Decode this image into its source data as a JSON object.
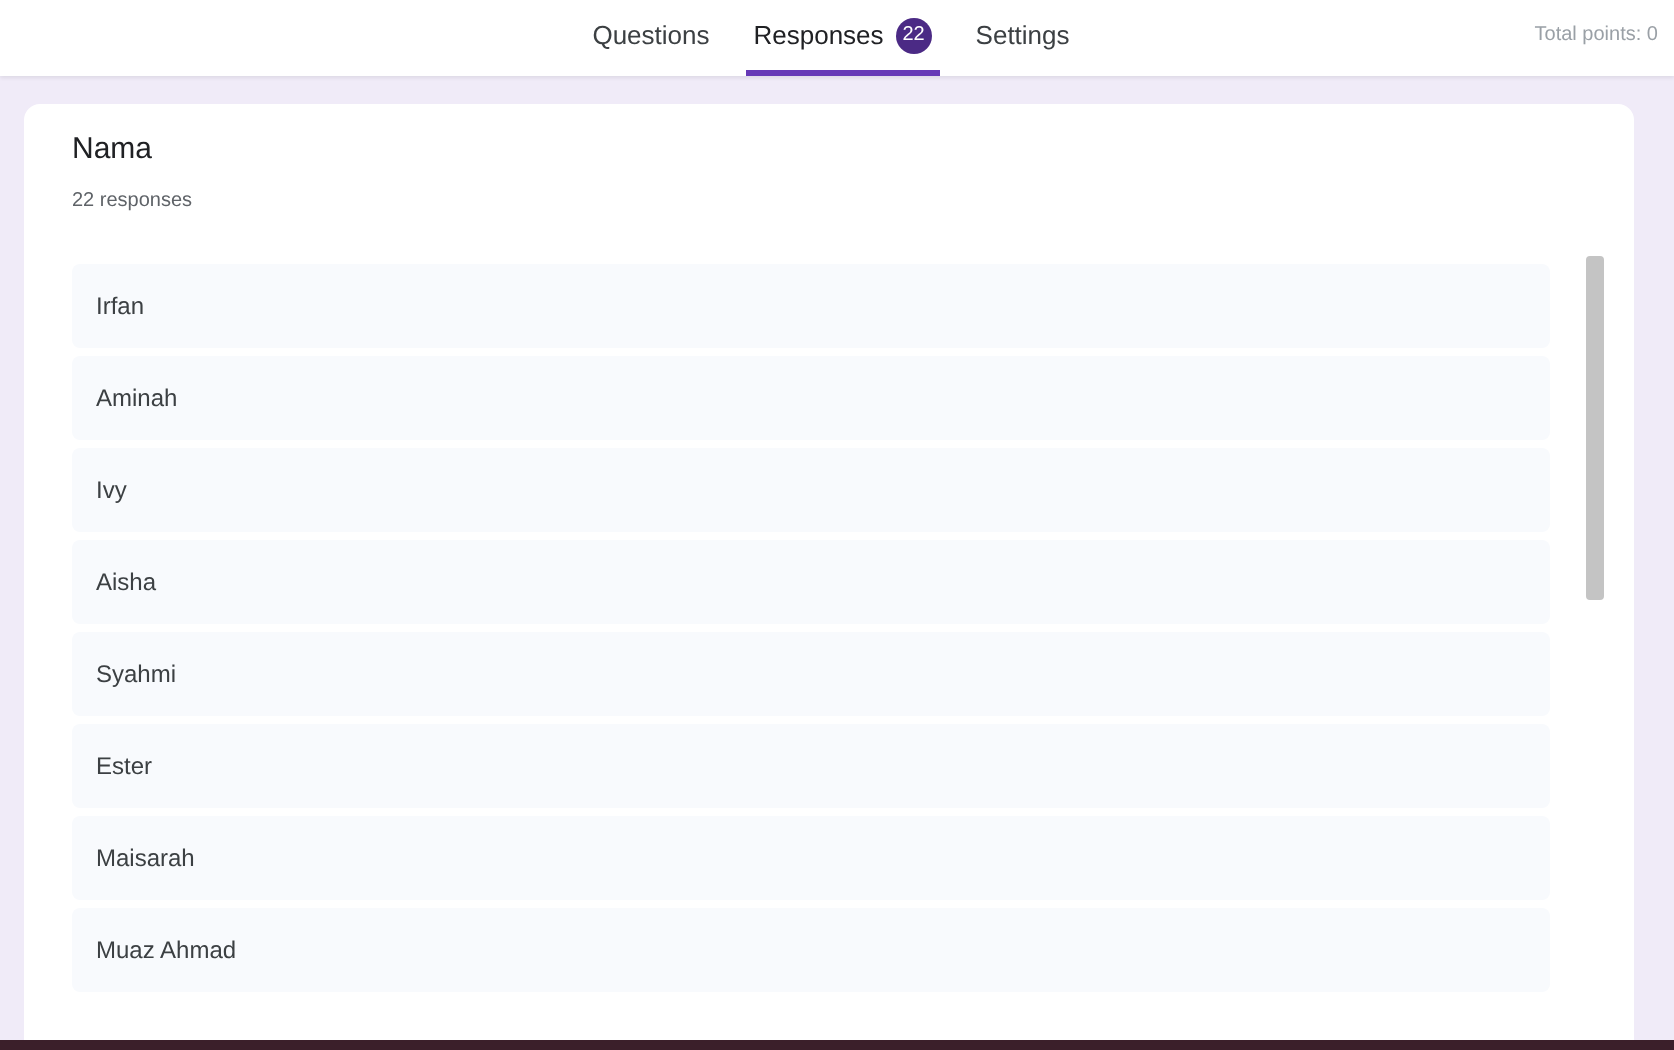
{
  "tabs": [
    {
      "label": "Questions",
      "selected": false
    },
    {
      "label": "Responses",
      "selected": true,
      "badge": "22"
    },
    {
      "label": "Settings",
      "selected": false
    }
  ],
  "total_points": "Total points: 0",
  "question": {
    "title": "Nama",
    "count": "22 responses",
    "responses": [
      "Irfan",
      "Aminah",
      "Ivy",
      "Aisha",
      "Syahmi",
      "Ester",
      "Maisarah",
      "Muaz Ahmad"
    ]
  }
}
